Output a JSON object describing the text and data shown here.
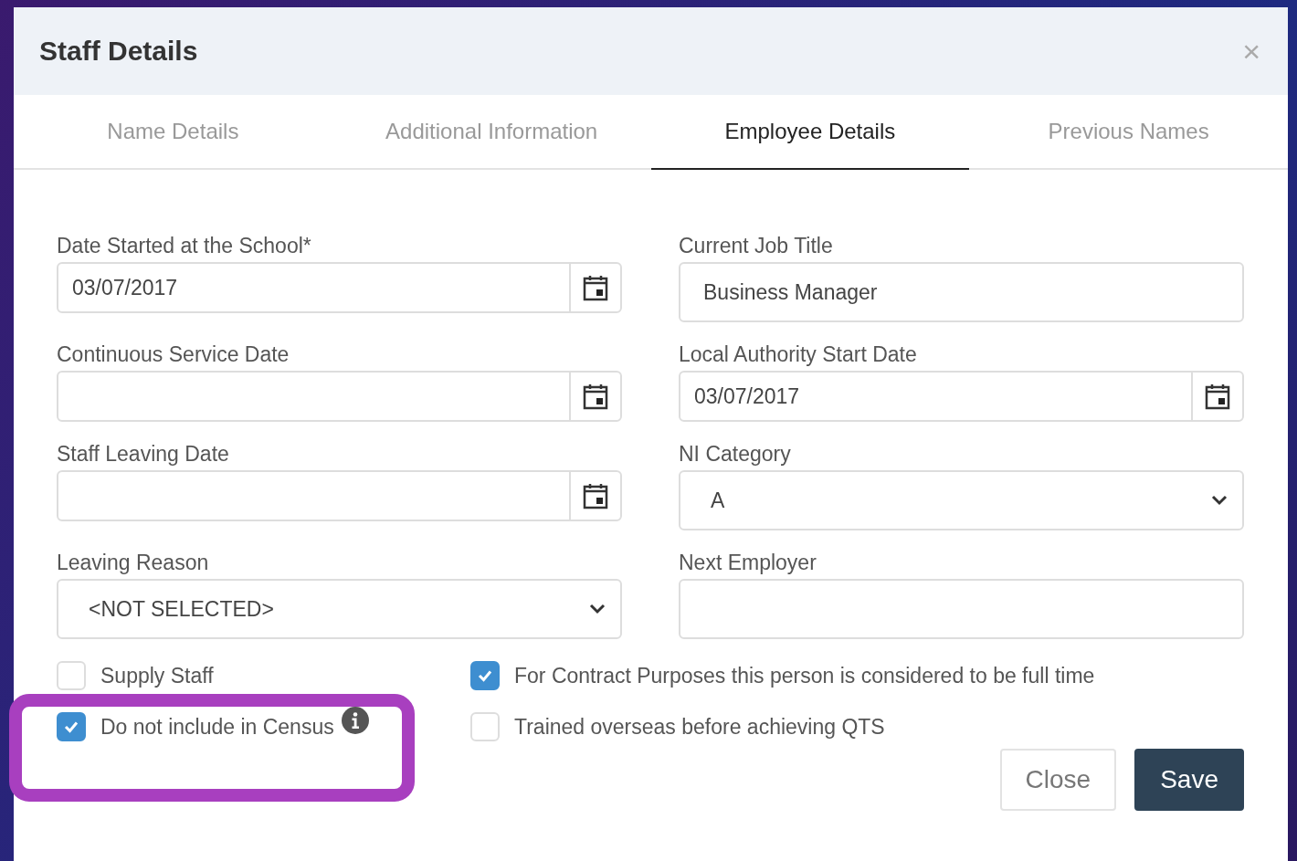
{
  "dialog": {
    "title": "Staff Details",
    "close_icon": "×"
  },
  "tabs": [
    {
      "label": "Name Details",
      "selected": false
    },
    {
      "label": "Additional Information",
      "selected": false
    },
    {
      "label": "Employee Details",
      "selected": true
    },
    {
      "label": "Previous Names",
      "selected": false
    }
  ],
  "fields": [
    {
      "label": "Date Started at the School*",
      "kind": "date",
      "value": "03/07/2017"
    },
    {
      "label": "Current Job Title",
      "kind": "text",
      "value": "Business Manager"
    },
    {
      "label": "Continuous Service Date",
      "kind": "date"
    },
    {
      "label": "Local Authority Start Date",
      "kind": "date",
      "value": "03/07/2017"
    },
    {
      "label": "Staff Leaving Date",
      "kind": "date"
    },
    {
      "label": "NI Category",
      "kind": "select",
      "value": "A"
    },
    {
      "label": "Leaving Reason",
      "kind": "select",
      "value": "<NOT SELECTED>"
    },
    {
      "label": "Next Employer",
      "kind": "text"
    }
  ],
  "checkboxes": [
    {
      "label": "Supply Staff",
      "checked": false,
      "info": false,
      "highlighted": false
    },
    {
      "label": "For Contract Purposes this person is considered to be full time",
      "checked": true,
      "info": false,
      "highlighted": false
    },
    {
      "label": "Do not include in Census",
      "checked": true,
      "info": true,
      "highlighted": true
    },
    {
      "label": "Trained overseas before achieving QTS",
      "checked": false,
      "info": false,
      "highlighted": false
    }
  ],
  "buttons": [
    {
      "label": "Close",
      "kind": "secondary"
    },
    {
      "label": "Save",
      "kind": "primary"
    }
  ]
}
